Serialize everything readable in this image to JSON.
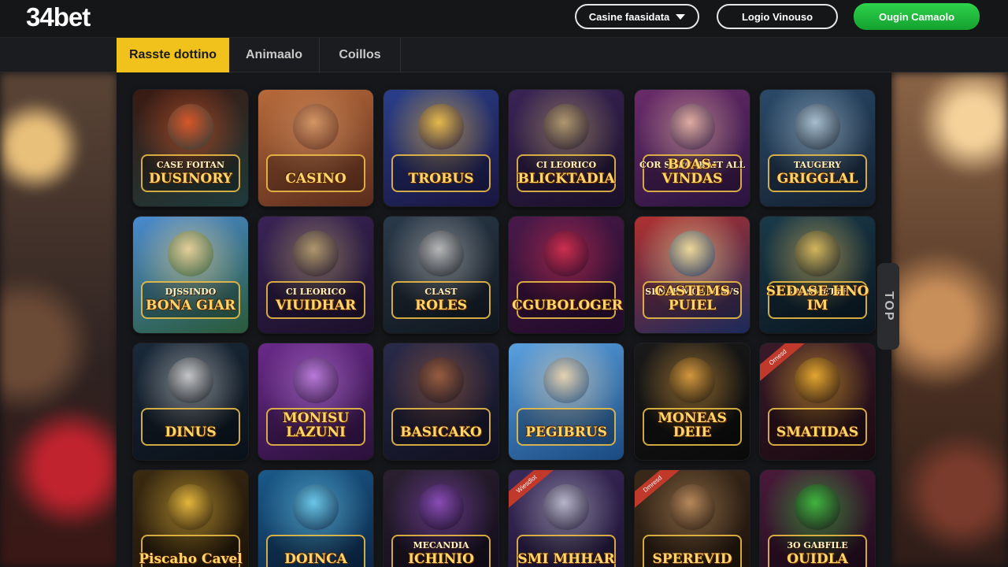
{
  "header": {
    "logo": "34bet",
    "select_label": "Casine faasidata",
    "login_label": "Logio Vinouso",
    "register_label": "Ougin Camaolo"
  },
  "tabs": [
    {
      "label": "Rasste dottino",
      "active": true
    },
    {
      "label": "Animaalo",
      "active": false
    },
    {
      "label": "Coillos",
      "active": false
    }
  ],
  "side_tab": {
    "label": "TOP"
  },
  "games": [
    {
      "title": "DUSINORY",
      "subtitle": "CASE FOITAN",
      "colors": [
        "#3b1a12",
        "#1d3a3a"
      ],
      "accent": "#e35a2a"
    },
    {
      "title": "CASINO",
      "subtitle": "",
      "colors": [
        "#b86a3a",
        "#5a2c1d"
      ],
      "accent": "#d89a6a"
    },
    {
      "title": "TROBUS",
      "subtitle": "",
      "colors": [
        "#2a3f8a",
        "#1a1540"
      ],
      "accent": "#f3c34a"
    },
    {
      "title": "BLICKTADIA",
      "subtitle": "CI LEORICO",
      "colors": [
        "#3a2456",
        "#1a102a"
      ],
      "accent": "#b8a070"
    },
    {
      "title": "BOAS-VINDAS",
      "subtitle": "COR SURCARAIT ALL",
      "colors": [
        "#6a2c6a",
        "#2a1440"
      ],
      "accent": "#e8b6a6"
    },
    {
      "title": "GRIGGLAL",
      "subtitle": "TAUGERY",
      "colors": [
        "#2a4a6a",
        "#142030"
      ],
      "accent": "#b0c8d8"
    },
    {
      "title": "BONA GIAR",
      "subtitle": "DJSSINDO",
      "colors": [
        "#4a8ad0",
        "#2a5a3a"
      ],
      "accent": "#f0d49a"
    },
    {
      "title": "VIUIDHAR",
      "subtitle": "CI LEORICO",
      "colors": [
        "#3a2456",
        "#1a102a"
      ],
      "accent": "#b8a070"
    },
    {
      "title": "ROLES",
      "subtitle": "CLAST",
      "colors": [
        "#2a3a4a",
        "#10161e"
      ],
      "accent": "#c0c0c0"
    },
    {
      "title": "CGUBOLOGER",
      "subtitle": "",
      "colors": [
        "#4a1a4a",
        "#200a2a"
      ],
      "accent": "#d83050"
    },
    {
      "title": "CASTEMS PUIEL",
      "subtitle": "SENSE MOASHAVS",
      "colors": [
        "#b03030",
        "#1a2a5a"
      ],
      "accent": "#f4e4a0"
    },
    {
      "title": "SEDASE HNO IM",
      "subtitle": "SRASMETTE",
      "colors": [
        "#1a3a4a",
        "#0a1620"
      ],
      "accent": "#e0c060"
    },
    {
      "title": "DINUS",
      "subtitle": "",
      "colors": [
        "#1a2a3a",
        "#0a1018"
      ],
      "accent": "#d0d0d0"
    },
    {
      "title": "MONISU LAZUNI",
      "subtitle": "",
      "colors": [
        "#6a2a8a",
        "#2a103a"
      ],
      "accent": "#c080e0"
    },
    {
      "title": "BASICAKO",
      "subtitle": "",
      "colors": [
        "#2a2a4a",
        "#101020"
      ],
      "accent": "#a06040"
    },
    {
      "title": "PEGIBRUS",
      "subtitle": "",
      "colors": [
        "#5aa0e0",
        "#1a4a80"
      ],
      "accent": "#f0d8b0"
    },
    {
      "title": "MONEAS DEIE",
      "subtitle": "",
      "colors": [
        "#1a1a1a",
        "#0a0a0a"
      ],
      "accent": "#e0a040"
    },
    {
      "title": "SMATIDAS",
      "subtitle": "",
      "colors": [
        "#3a1a2a",
        "#1a0a10"
      ],
      "accent": "#f0b030",
      "ribbon": "Ornesd"
    },
    {
      "title": "Piscaho Cavel",
      "subtitle": "",
      "colors": [
        "#3a2a10",
        "#1a1008"
      ],
      "accent": "#f0c040"
    },
    {
      "title": "DOINCA",
      "subtitle": "",
      "colors": [
        "#1a5a8a",
        "#0a2040"
      ],
      "accent": "#70d0f0"
    },
    {
      "title": "ICHINIO",
      "subtitle": "MECANDIA",
      "colors": [
        "#2a2030",
        "#100a18"
      ],
      "accent": "#9050c0"
    },
    {
      "title": "SMI MHHAR",
      "subtitle": "",
      "colors": [
        "#3a2a5a",
        "#1a1030"
      ],
      "accent": "#c0c0d0",
      "ribbon": "Wiesdlot"
    },
    {
      "title": "SPEREVID",
      "subtitle": "",
      "colors": [
        "#3a2a1a",
        "#1a100a"
      ],
      "accent": "#c09060",
      "ribbon": "Dmresd"
    },
    {
      "title": "OUIDLA",
      "subtitle": "3O GABFILE",
      "colors": [
        "#4a1a3a",
        "#1a0a18"
      ],
      "accent": "#40c040"
    }
  ]
}
